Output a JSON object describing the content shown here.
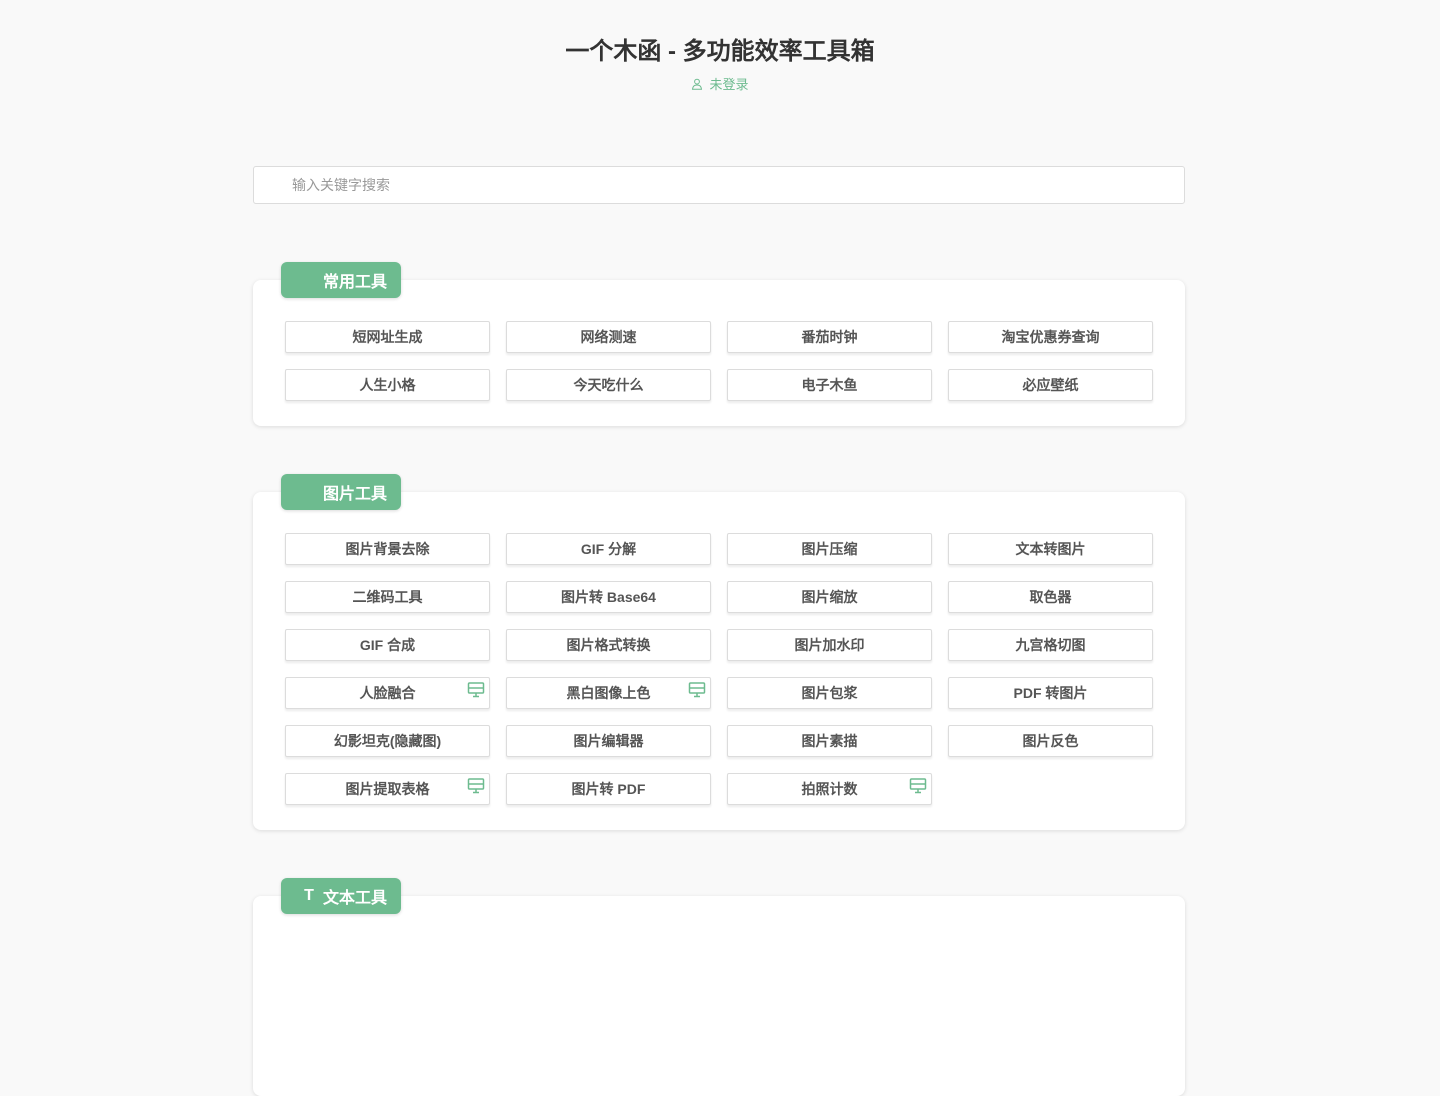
{
  "header": {
    "title": "一个木函 - 多功能效率工具箱",
    "login_status": "未登录",
    "accent_color": "#6dbb8f"
  },
  "search": {
    "placeholder": "输入关键字搜索",
    "value": ""
  },
  "sections": [
    {
      "title": "常用工具",
      "icon": "",
      "tools": [
        {
          "label": "短网址生成",
          "desktop": false
        },
        {
          "label": "网络测速",
          "desktop": false
        },
        {
          "label": "番茄时钟",
          "desktop": false
        },
        {
          "label": "淘宝优惠券查询",
          "desktop": false
        },
        {
          "label": "人生小格",
          "desktop": false
        },
        {
          "label": "今天吃什么",
          "desktop": false
        },
        {
          "label": "电子木鱼",
          "desktop": false
        },
        {
          "label": "必应壁纸",
          "desktop": false
        }
      ]
    },
    {
      "title": "图片工具",
      "icon": "",
      "tools": [
        {
          "label": "图片背景去除",
          "desktop": false
        },
        {
          "label": "GIF 分解",
          "desktop": false
        },
        {
          "label": "图片压缩",
          "desktop": false
        },
        {
          "label": "文本转图片",
          "desktop": false
        },
        {
          "label": "二维码工具",
          "desktop": false
        },
        {
          "label": "图片转 Base64",
          "desktop": false
        },
        {
          "label": "图片缩放",
          "desktop": false
        },
        {
          "label": "取色器",
          "desktop": false
        },
        {
          "label": "GIF 合成",
          "desktop": false
        },
        {
          "label": "图片格式转换",
          "desktop": false
        },
        {
          "label": "图片加水印",
          "desktop": false
        },
        {
          "label": "九宫格切图",
          "desktop": false
        },
        {
          "label": "人脸融合",
          "desktop": true
        },
        {
          "label": "黑白图像上色",
          "desktop": true
        },
        {
          "label": "图片包浆",
          "desktop": false
        },
        {
          "label": "PDF 转图片",
          "desktop": false
        },
        {
          "label": "幻影坦克(隐藏图)",
          "desktop": false
        },
        {
          "label": "图片编辑器",
          "desktop": false
        },
        {
          "label": "图片素描",
          "desktop": false
        },
        {
          "label": "图片反色",
          "desktop": false
        },
        {
          "label": "图片提取表格",
          "desktop": true
        },
        {
          "label": "图片转 PDF",
          "desktop": false
        },
        {
          "label": "拍照计数",
          "desktop": true
        }
      ]
    },
    {
      "title": "文本工具",
      "icon": "T",
      "tools": []
    }
  ]
}
